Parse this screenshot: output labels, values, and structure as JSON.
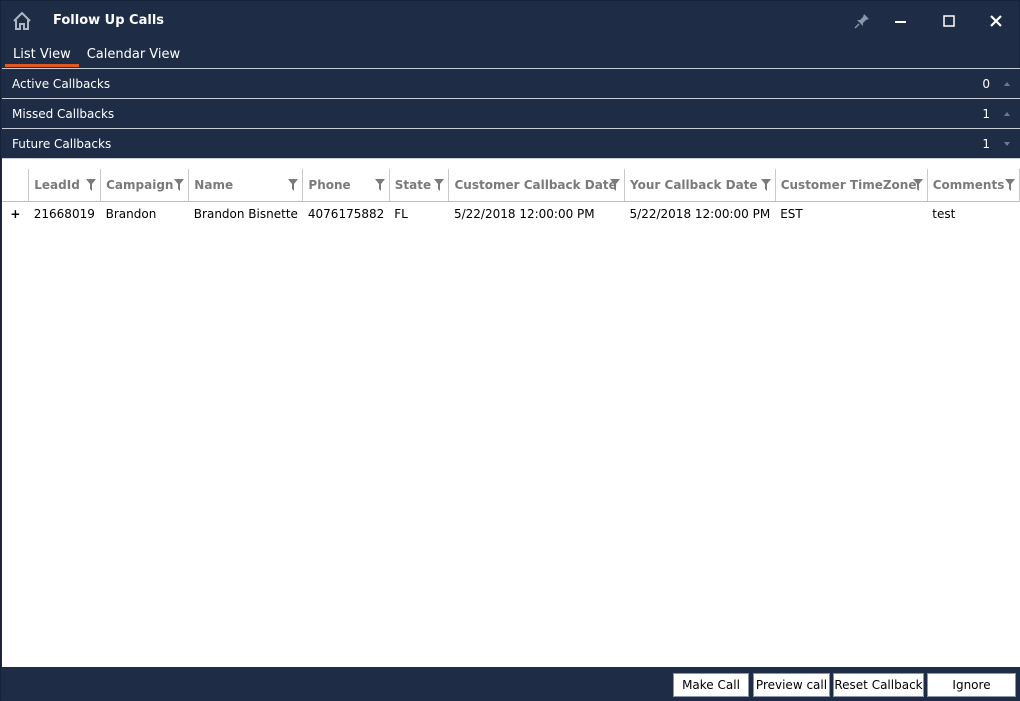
{
  "window": {
    "title": "Follow Up Calls"
  },
  "tabs": [
    {
      "label": "List View",
      "active": true
    },
    {
      "label": "Calendar View",
      "active": false
    }
  ],
  "sections": [
    {
      "label": "Active Callbacks",
      "count": "0"
    },
    {
      "label": "Missed Callbacks",
      "count": "1"
    },
    {
      "label": "Future Callbacks",
      "count": "1"
    }
  ],
  "grid": {
    "columns": [
      "LeadId",
      "Campaign",
      "Name",
      "Phone",
      "State",
      "Customer Callback Date",
      "Your Callback Date",
      "Customer TimeZone",
      "Comments"
    ],
    "rows": [
      {
        "expander": "+",
        "cells": [
          "21668019",
          "Brandon",
          "Brandon Bisnette",
          "4076175882",
          "FL",
          "5/22/2018 12:00:00 PM",
          "5/22/2018 12:00:00 PM",
          "EST",
          "test"
        ]
      }
    ]
  },
  "footer": {
    "make_call": "Make Call",
    "preview_call": "Preview call",
    "reset_callback": "Reset Callback",
    "ignore": "Ignore"
  },
  "colors": {
    "background": "#1e2d45",
    "accent": "#e05a1f",
    "panel": "#ffffff"
  },
  "icons": {
    "home": "home-icon",
    "pin": "pin-icon",
    "minimize": "minimize-icon",
    "maximize": "maximize-icon",
    "close": "close-icon",
    "filter": "filter-icon",
    "arrow_up": "chevron-up-icon",
    "arrow_down": "chevron-down-icon"
  }
}
